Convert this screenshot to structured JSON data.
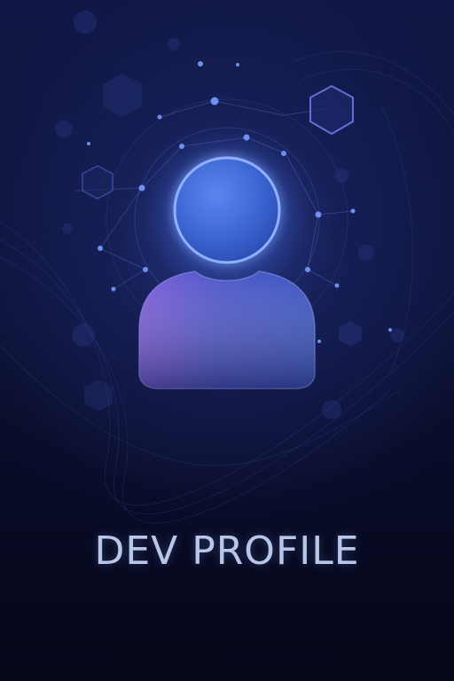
{
  "title": "DEV PROFILE",
  "icons": {
    "avatar": "user-silhouette-icon",
    "hexagon": "hexagon-icon",
    "network": "network-node-icon"
  },
  "colors": {
    "background": "#0b1030",
    "avatar_head": "#3f6fd8",
    "avatar_body_left": "#7a5ad8",
    "avatar_body_right": "#3b5fc8",
    "node": "#6f8ff0",
    "title": "#b8c6ea"
  }
}
